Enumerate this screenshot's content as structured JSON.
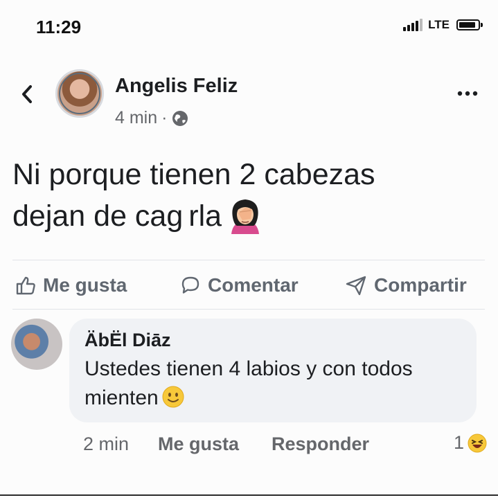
{
  "status_bar": {
    "time": "11:29",
    "network": "LTE",
    "icons": [
      "signal-icon",
      "battery-icon"
    ]
  },
  "post": {
    "author": "Angelis Feliz",
    "timestamp": "4 min",
    "separator": "·",
    "audience_icon": "globe-icon",
    "text_line_1": "Ni porque tienen 2 cabezas",
    "text_line_2": "dejan de cag",
    "text_line_2_rest": "rla",
    "emoji": "woman-facepalming-emoji"
  },
  "actions": {
    "like_label": "Me gusta",
    "comment_label": "Comentar",
    "share_label": "Compartir"
  },
  "comment": {
    "author": "ÄbËl Diāz",
    "text": "Ustedes tienen 4 labios y con todos mienten",
    "emoji": "slightly-smiling-face-emoji",
    "timestamp": "2 min",
    "like_label": "Me gusta",
    "reply_label": "Responder",
    "reaction_count": "1",
    "reaction_emoji": "laughing-face-emoji"
  },
  "colors": {
    "text_primary": "#1c1e21",
    "text_secondary": "#65676b",
    "bubble_bg": "#f0f2f5",
    "divider": "#e1e3e7"
  }
}
